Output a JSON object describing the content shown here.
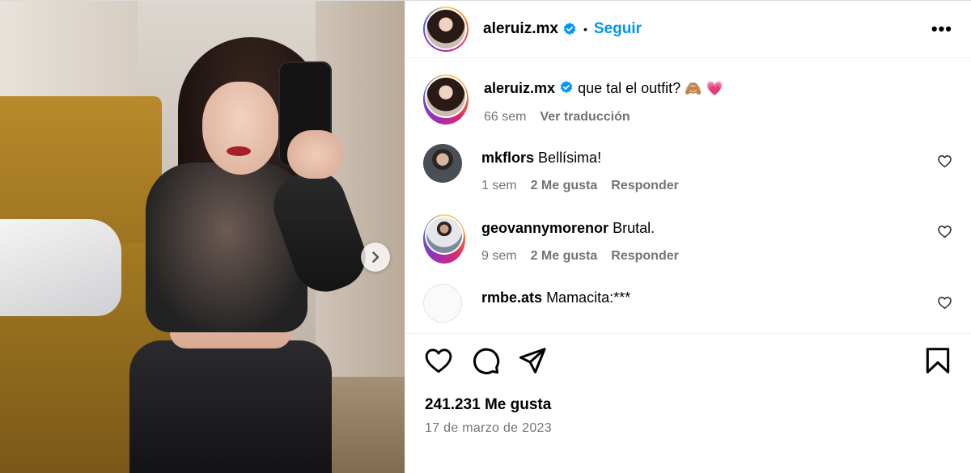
{
  "post": {
    "author": "aleruiz.mx",
    "follow_label": "Seguir",
    "separator": "•",
    "more_label": "•••",
    "caption_text": "que tal el outfit?",
    "caption_emoji": "🙈 💗",
    "caption_time": "66 sem",
    "translate_label": "Ver traducción",
    "likes": "241.231 Me gusta",
    "date": "17 de marzo de 2023"
  },
  "comments": [
    {
      "user": "mkflors",
      "text": "Bellísima!",
      "time": "1 sem",
      "likes": "2 Me gusta",
      "reply": "Responder"
    },
    {
      "user": "geovannymorenor",
      "text": "Brutal.",
      "time": "9 sem",
      "likes": "2 Me gusta",
      "reply": "Responder"
    },
    {
      "user": "rmbe.ats",
      "text": "Mamacita:***"
    }
  ],
  "colors": {
    "accent": "#0095f6",
    "muted": "#737373",
    "verified": "#0095f6"
  },
  "icons": [
    "chevron-right-icon",
    "verified-badge-icon",
    "heart-icon",
    "comment-icon",
    "share-icon",
    "bookmark-icon",
    "more-icon"
  ]
}
